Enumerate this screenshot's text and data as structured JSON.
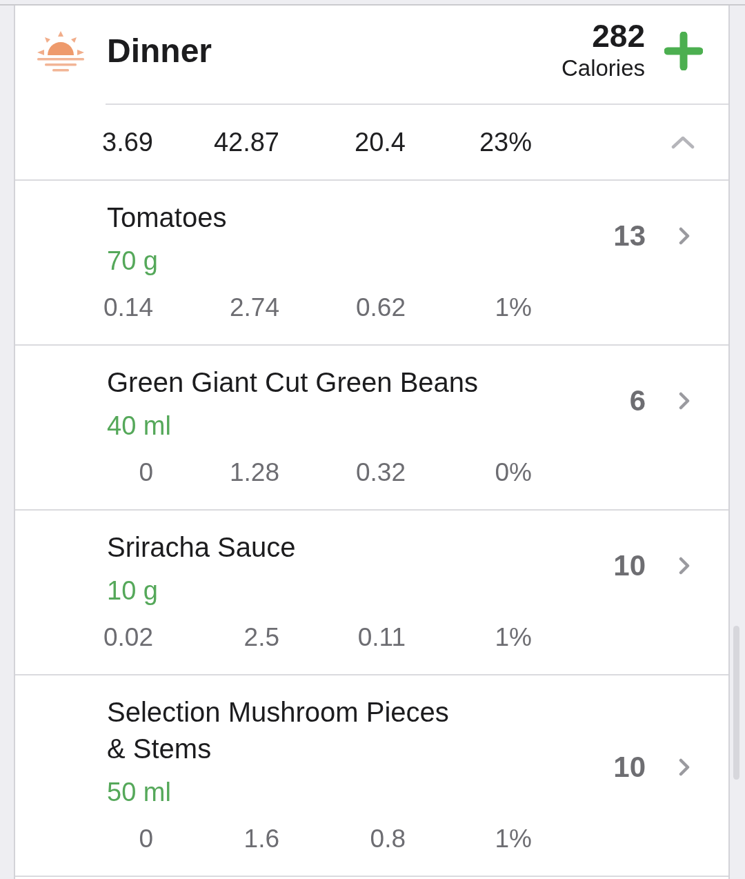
{
  "meal": {
    "title": "Dinner",
    "calories": "282",
    "calories_label": "Calories"
  },
  "summary": {
    "values": [
      "3.69",
      "42.87",
      "20.4",
      "23%"
    ],
    "expanded": true
  },
  "foods": [
    {
      "name": "Tomatoes",
      "amount": "70 g",
      "calories": "13",
      "nutrients": [
        "0.14",
        "2.74",
        "0.62",
        "1%"
      ]
    },
    {
      "name": "Green Giant Cut Green Beans",
      "amount": "40 ml",
      "calories": "6",
      "nutrients": [
        "0",
        "1.28",
        "0.32",
        "0%"
      ]
    },
    {
      "name": "Sriracha Sauce",
      "amount": "10 g",
      "calories": "10",
      "nutrients": [
        "0.02",
        "2.5",
        "0.11",
        "1%"
      ]
    },
    {
      "name": "Selection Mushroom Pieces & Stems",
      "amount": "50 ml",
      "calories": "10",
      "nutrients": [
        "0",
        "1.6",
        "0.8",
        "1%"
      ]
    }
  ]
}
